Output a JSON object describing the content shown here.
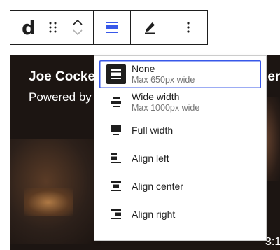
{
  "toolbar": {
    "block_icon_text": "d",
    "buttons": [
      "drag",
      "move-up",
      "move-down",
      "align",
      "edit",
      "more-options"
    ]
  },
  "video": {
    "title_left": "Joe Cocke",
    "title_right": "ter",
    "subtitle": "Powered by",
    "timestamp": "3:1"
  },
  "menu": {
    "items": [
      {
        "label": "None",
        "description": "Max 650px wide",
        "icon": "align-none-icon",
        "selected": true
      },
      {
        "label": "Wide width",
        "description": "Max 1000px wide",
        "icon": "align-wide-icon",
        "selected": false
      },
      {
        "label": "Full width",
        "description": "",
        "icon": "align-full-icon",
        "selected": false
      },
      {
        "label": "Align left",
        "description": "",
        "icon": "align-left-icon",
        "selected": false
      },
      {
        "label": "Align center",
        "description": "",
        "icon": "align-center-icon",
        "selected": false
      },
      {
        "label": "Align right",
        "description": "",
        "icon": "align-right-icon",
        "selected": false
      }
    ]
  },
  "colors": {
    "accent": "#3858e9",
    "text": "#1e1e1e",
    "muted": "#757575",
    "border": "#1e1e1e"
  }
}
